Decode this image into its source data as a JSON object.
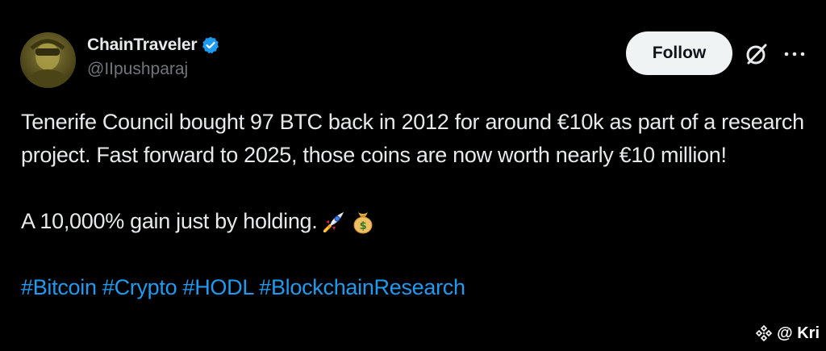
{
  "user": {
    "display_name": "ChainTraveler",
    "handle": "@IIpushparaj",
    "verified": true
  },
  "actions": {
    "follow_label": "Follow"
  },
  "tweet": {
    "paragraph_1": "Tenerife Council bought 97 BTC back in 2012 for around €10k as part of a research project. Fast forward to 2025, those coins are now worth nearly €10 million!",
    "paragraph_2": "A 10,000% gain just by holding.",
    "emojis": [
      "rocket-emoji",
      "money-bag-emoji"
    ],
    "hashtags": [
      "#Bitcoin",
      "#Crypto",
      "#HODL",
      "#BlockchainResearch"
    ]
  },
  "watermark": {
    "text": "@ Kri"
  },
  "colors": {
    "background": "#000000",
    "text": "#e7e9ea",
    "secondary_text": "#71767b",
    "link": "#1d9bf0",
    "verified_badge": "#1d9bf0",
    "follow_bg": "#eff3f4"
  }
}
